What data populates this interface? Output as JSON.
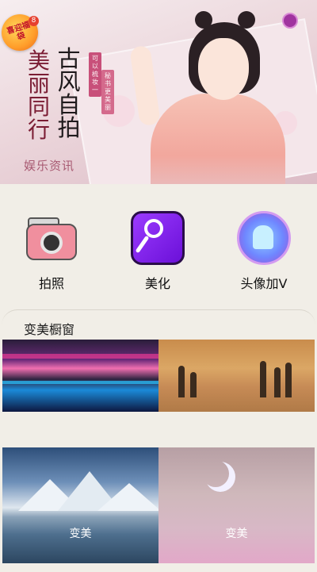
{
  "banner": {
    "title_line1": "美丽同行",
    "title_line2": "古风自拍",
    "sub_line1": "可以梳妆一",
    "sub_line2": "秘书更美丽",
    "footer": "娱乐资讯",
    "badge_text": "喜迎福袋",
    "badge_count": "8"
  },
  "quick_actions": [
    {
      "label": "拍照",
      "icon": "camera-icon"
    },
    {
      "label": "美化",
      "icon": "hand-mirror-icon"
    },
    {
      "label": "头像加V",
      "icon": "avatar-v-icon"
    }
  ],
  "showcase": {
    "title": "变美橱窗",
    "items": [
      {
        "caption": ""
      },
      {
        "caption": ""
      },
      {
        "caption": "变美"
      },
      {
        "caption": "变美"
      }
    ]
  },
  "colors": {
    "background": "#f1eee7",
    "banner_title": "#7b1d34",
    "beauty_purple": "#8a2be2"
  }
}
